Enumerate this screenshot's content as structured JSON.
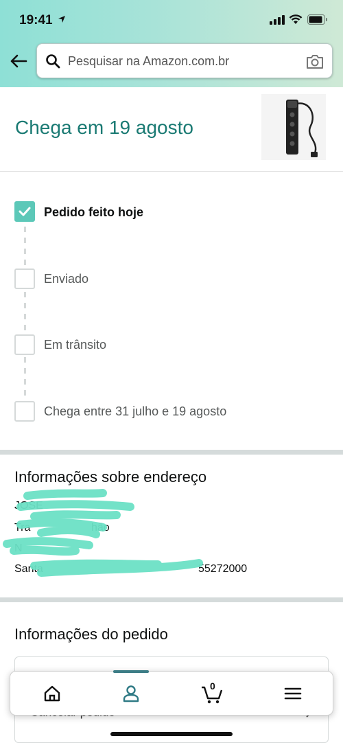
{
  "status_bar": {
    "time": "19:41"
  },
  "search": {
    "placeholder": "Pesquisar na Amazon.com.br"
  },
  "delivery": {
    "headline": "Chega em 19 agosto"
  },
  "timeline": {
    "steps": [
      {
        "label": "Pedido feito hoje",
        "done": true
      },
      {
        "label": "Enviado",
        "done": false
      },
      {
        "label": "Em trânsito",
        "done": false
      },
      {
        "label": "Chega entre 31 julho e 19 agosto",
        "done": false
      }
    ]
  },
  "address": {
    "title": "Informações sobre endereço",
    "lines": [
      "JOSE ",
      "Tra",
      "N",
      "Santa",
      "hão",
      "55272000"
    ]
  },
  "order": {
    "title": "Informações do pedido",
    "cancel_label": "Cancelar pedido"
  },
  "tabs": {
    "active": "account",
    "cart_count": "0"
  },
  "colors": {
    "accent": "#1a7a73",
    "check": "#5cc8b8",
    "header_gradient_start": "#8ee0d6",
    "header_gradient_end": "#cfe9d6"
  }
}
